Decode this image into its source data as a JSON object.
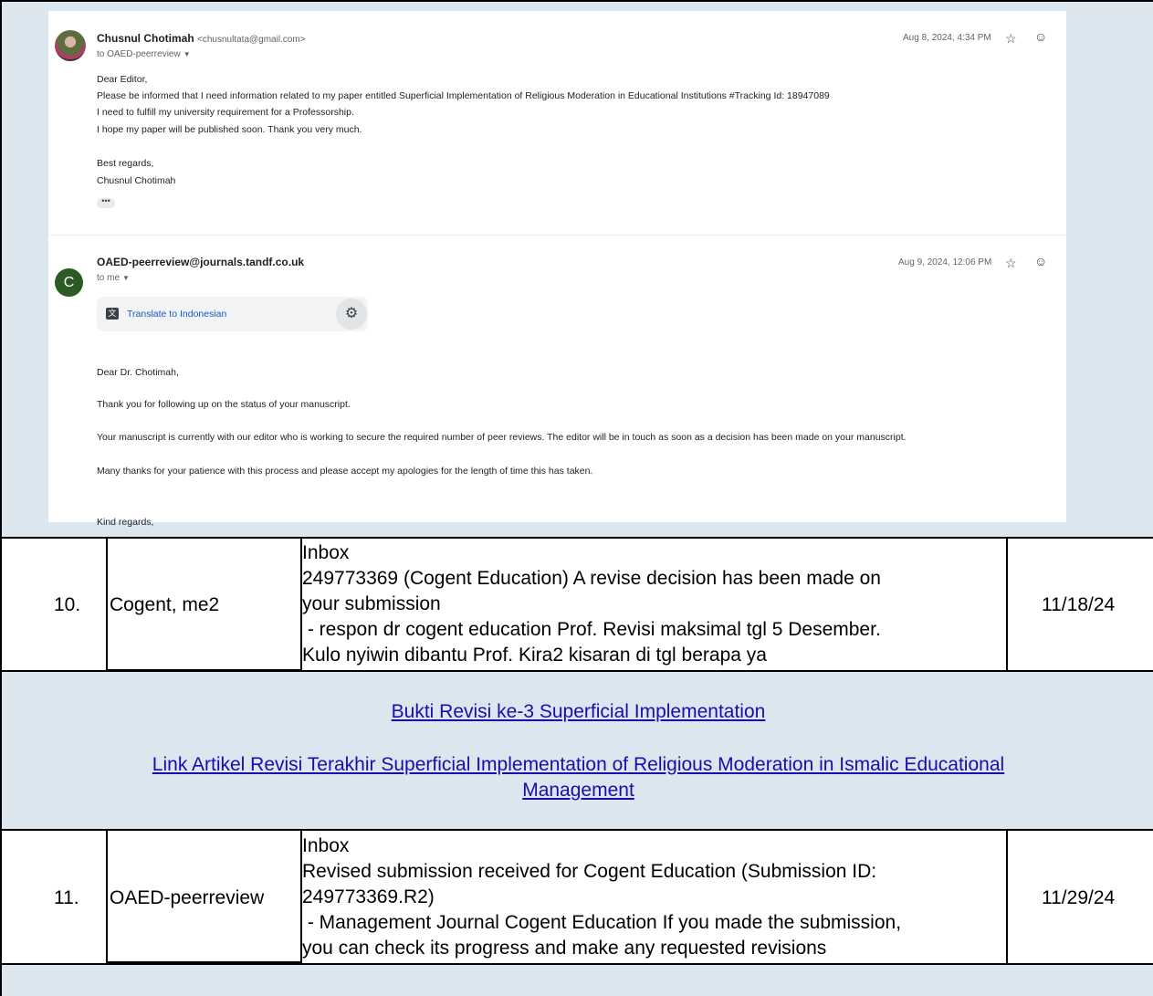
{
  "email_thread": {
    "message1": {
      "sender_name": "Chusnul Chotimah",
      "sender_email": "<chusnultata@gmail.com>",
      "to": "to OAED-peerreview",
      "date": "Aug 8, 2024, 4:34 PM",
      "body": [
        "Dear Editor,",
        "Please be informed that I need information related to my paper entitled Superficial Implementation of Religious Moderation in Educational Institutions #Tracking Id: 18947089",
        "I need to fulfill my university requirement for a Professorship.",
        "I hope my paper will be published soon. Thank you very much.",
        "",
        "Best regards,",
        "Chusnul Chotimah"
      ],
      "ellipsis": "•••"
    },
    "message2": {
      "avatar_letter": "C",
      "sender_name": "OAED-peerreview@journals.tandf.co.uk",
      "to": "to me",
      "date": "Aug 9, 2024, 12:06 PM",
      "translate_label": "Translate to Indonesian",
      "body": [
        "Dear Dr. Chotimah,",
        "Thank you for following up on the status of your manuscript.",
        "Your manuscript is currently with our editor who is working to secure the required number of peer reviews. The editor will be in touch as soon as a decision has been made on your manuscript.",
        "Many thanks for your patience with this process and please accept my apologies for the length of time this has taken.",
        "Kind regards,"
      ]
    }
  },
  "rows": [
    {
      "number": "10.",
      "from": "Cogent, me2",
      "subject_lines": [
        "Inbox",
        "249773369 (Cogent Education) A revise decision has been made on",
        "your submission",
        " - respon dr cogent education Prof. Revisi maksimal tgl 5 Desember.",
        "Kulo nyiwin dibantu Prof. Kira2 kisaran di tgl berapa ya"
      ],
      "date": "11/18/24"
    },
    {
      "number": "11.",
      "from": "OAED-peerreview",
      "subject_lines": [
        "Inbox",
        "Revised submission received for Cogent Education (Submission ID:",
        "249773369.R2)",
        " - Management Journal Cogent Education If you made the submission,",
        "you can check its progress and make any requested revisions"
      ],
      "date": "11/29/24"
    }
  ],
  "links": {
    "link1": "Bukti Revisi ke-3 Superficial Implementation",
    "link2_line1": "Link Artikel Revisi Terakhir Superficial Implementation of Religious Moderation in Ismalic Educational",
    "link2_line2": "Management"
  },
  "colors": {
    "band_background": "#dbe6ee",
    "link_color": "#1a0dab",
    "avatar_green": "#2b5a24"
  }
}
